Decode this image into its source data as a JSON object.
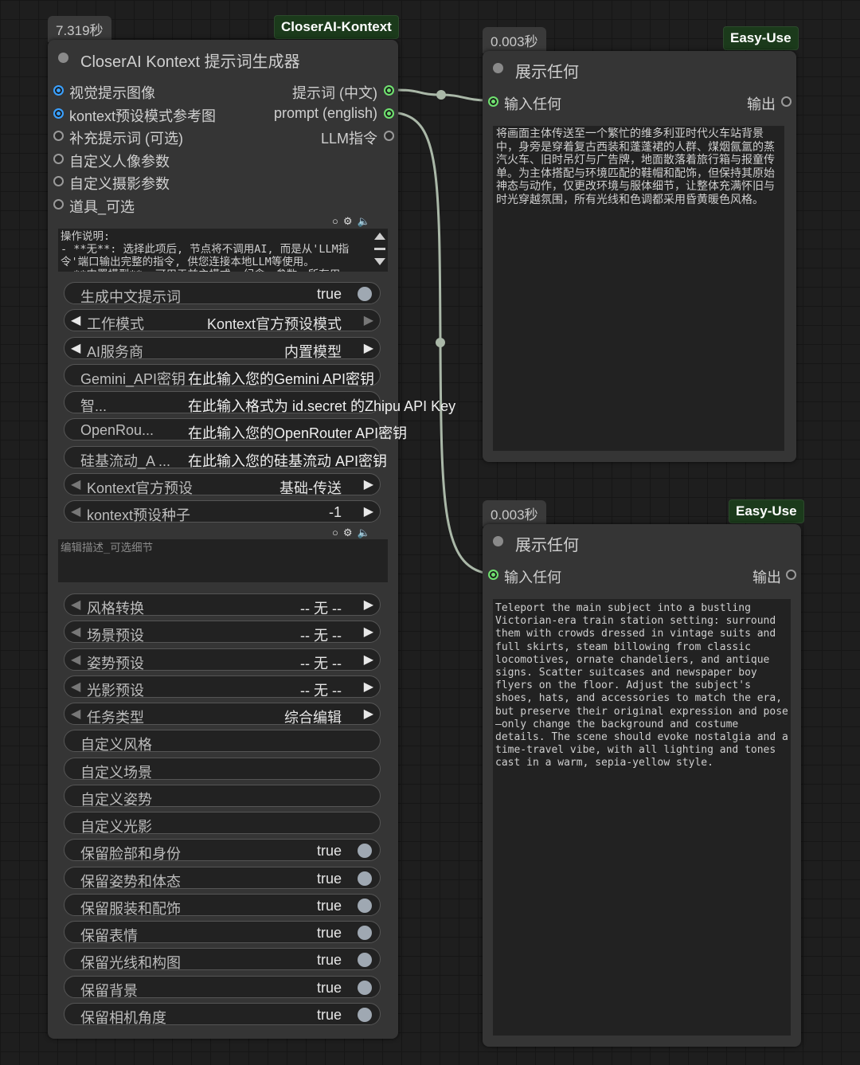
{
  "main_node": {
    "time": "7.319秒",
    "tag": "CloserAI-Kontext",
    "title": "CloserAI Kontext 提示词生成器",
    "inputs": [
      "视觉提示图像",
      "kontext预设模式参考图",
      "补充提示词 (可选)",
      "自定义人像参数",
      "自定义摄影参数",
      "道具_可选"
    ],
    "outputs": [
      "提示词 (中文)",
      "prompt (english)",
      "LLM指令"
    ],
    "instructions": "操作说明:\n- **无**: 选择此项后, 节点将不调用AI, 而是从'LLM指令'端口输出完整的指令, 供您连接本地LLM等使用。\n- **内置模型**: 可用于兹主模式, 纪念、参数、所有用",
    "widgets_a": [
      {
        "type": "toggle",
        "label": "生成中文提示词",
        "value": "true"
      },
      {
        "type": "combo",
        "label": "工作模式",
        "value": "Kontext官方预设模式",
        "dimR": true
      },
      {
        "type": "combo",
        "label": "AI服务商",
        "value": "内置模型"
      },
      {
        "type": "text",
        "label": "Gemini_API密钥",
        "value": "在此输入您的Gemini API密钥"
      },
      {
        "type": "text",
        "label": "智...",
        "value": "在此输入格式为 id.secret 的Zhipu API Key"
      },
      {
        "type": "text",
        "label": "OpenRou...",
        "value": "在此输入您的OpenRouter API密钥"
      },
      {
        "type": "text",
        "label": "硅基流动_A ...",
        "value": "在此输入您的硅基流动 API密钥"
      },
      {
        "type": "combo",
        "label": "Kontext官方预设",
        "value": "基础-传送",
        "dimL": true
      },
      {
        "type": "combo",
        "label": "kontext预设种子",
        "value": "-1",
        "dimL": true
      }
    ],
    "edit_placeholder": "编辑描述_可选细节",
    "widgets_b": [
      {
        "type": "combo",
        "label": "风格转换",
        "value": "-- 无 --",
        "dimL": true
      },
      {
        "type": "combo",
        "label": "场景预设",
        "value": "-- 无 --",
        "dimL": true
      },
      {
        "type": "combo",
        "label": "姿势预设",
        "value": "-- 无 --",
        "dimL": true
      },
      {
        "type": "combo",
        "label": "光影预设",
        "value": "-- 无 --",
        "dimL": true
      },
      {
        "type": "combo",
        "label": "任务类型",
        "value": "综合编辑",
        "dimL": true
      },
      {
        "type": "text",
        "label": "自定义风格",
        "value": ""
      },
      {
        "type": "text",
        "label": "自定义场景",
        "value": ""
      },
      {
        "type": "text",
        "label": "自定义姿势",
        "value": ""
      },
      {
        "type": "text",
        "label": "自定义光影",
        "value": ""
      },
      {
        "type": "toggle",
        "label": "保留脸部和身份",
        "value": "true"
      },
      {
        "type": "toggle",
        "label": "保留姿势和体态",
        "value": "true"
      },
      {
        "type": "toggle",
        "label": "保留服装和配饰",
        "value": "true"
      },
      {
        "type": "toggle",
        "label": "保留表情",
        "value": "true"
      },
      {
        "type": "toggle",
        "label": "保留光线和构图",
        "value": "true"
      },
      {
        "type": "toggle",
        "label": "保留背景",
        "value": "true"
      },
      {
        "type": "toggle",
        "label": "保留相机角度",
        "value": "true"
      }
    ]
  },
  "show_node_1": {
    "time": "0.003秒",
    "tag": "Easy-Use",
    "title": "展示任何",
    "input": "输入任何",
    "output": "输出",
    "text": "将画面主体传送至一个繁忙的维多利亚时代火车站背景中，身旁是穿着复古西装和蓬蓬裙的人群、煤烟氤氲的蒸汽火车、旧时吊灯与广告牌，地面散落着旅行箱与报童传单。为主体搭配与环境匹配的鞋帽和配饰，但保持其原始神态与动作，仅更改环境与服体细节，让整体充满怀旧与时光穿越氛围，所有光线和色调都采用昏黄暖色风格。"
  },
  "show_node_2": {
    "time": "0.003秒",
    "tag": "Easy-Use",
    "title": "展示任何",
    "input": "输入任何",
    "output": "输出",
    "text": "Teleport the main subject into a bustling Victorian-era train station setting: surround them with crowds dressed in vintage suits and full skirts, steam billowing from classic locomotives, ornate chandeliers, and antique signs. Scatter suitcases and newspaper boy flyers on the floor. Adjust the subject's shoes, hats, and accessories to match the era, but preserve their original expression and pose—only change the background and costume details. The scene should evoke nostalgia and a time-travel vibe, with all lighting and tones cast in a warm, sepia-yellow style."
  }
}
